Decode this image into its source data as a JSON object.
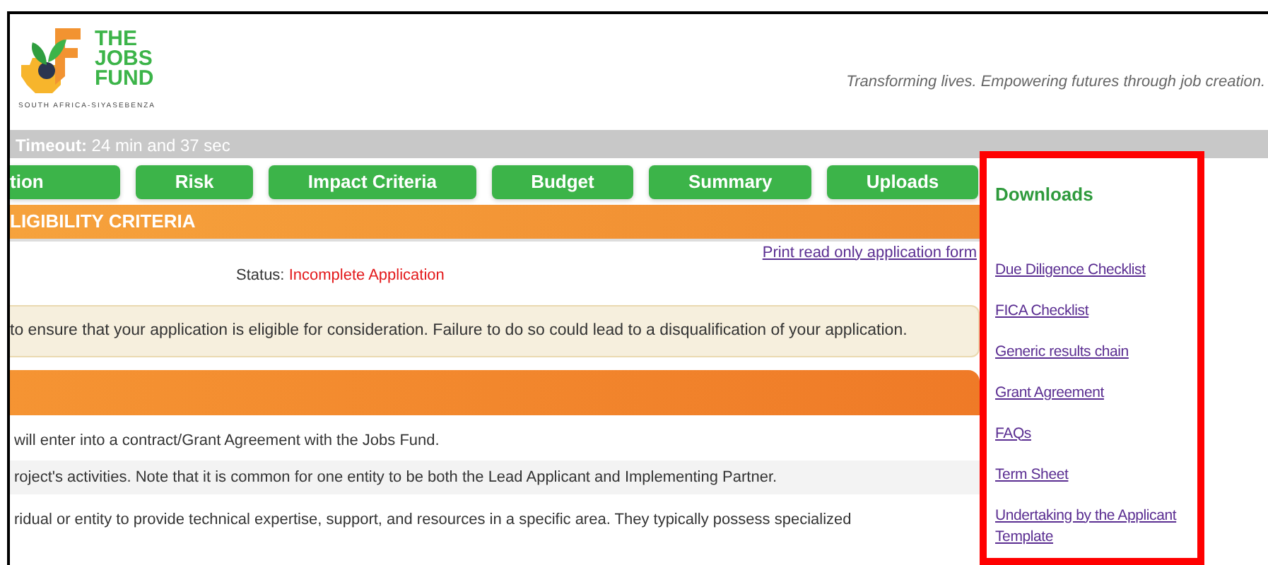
{
  "header": {
    "logo_title": [
      "THE",
      "JOBS",
      "FUND"
    ],
    "logo_subtitle": "SOUTH AFRICA-SIYASEBENZA",
    "tagline": "Transforming lives. Empowering futures through job creation."
  },
  "timeout": {
    "label": "Timeout:",
    "value": "24 min and 37 sec"
  },
  "tabs": [
    {
      "label": "tion"
    },
    {
      "label": "Risk"
    },
    {
      "label": "Impact Criteria"
    },
    {
      "label": "Budget"
    },
    {
      "label": "Summary"
    },
    {
      "label": "Uploads"
    }
  ],
  "section_title": "LIGIBILITY CRITERIA",
  "print_link": "Print read only application form",
  "status": {
    "label": "Status:",
    "value": "Incomplete Application"
  },
  "notice": "to ensure that your application is eligible for consideration. Failure to do so could lead to a disqualification of your application.",
  "paragraphs": [
    {
      "text": "will enter into a contract/Grant Agreement with the Jobs Fund.",
      "shaded": false
    },
    {
      "text": "roject's activities. Note that it is common for one entity to be both the Lead Applicant and Implementing Partner.",
      "shaded": true
    },
    {
      "text": "ridual or entity to provide technical expertise, support, and resources in a specific area. They typically possess specialized",
      "shaded": false
    }
  ],
  "downloads": {
    "title": "Downloads",
    "links": [
      "Due Diligence Checklist",
      "FICA Checklist",
      "Generic results chain",
      "Grant Agreement",
      "FAQs",
      "Term Sheet",
      "Undertaking by the Applicant Template"
    ]
  }
}
